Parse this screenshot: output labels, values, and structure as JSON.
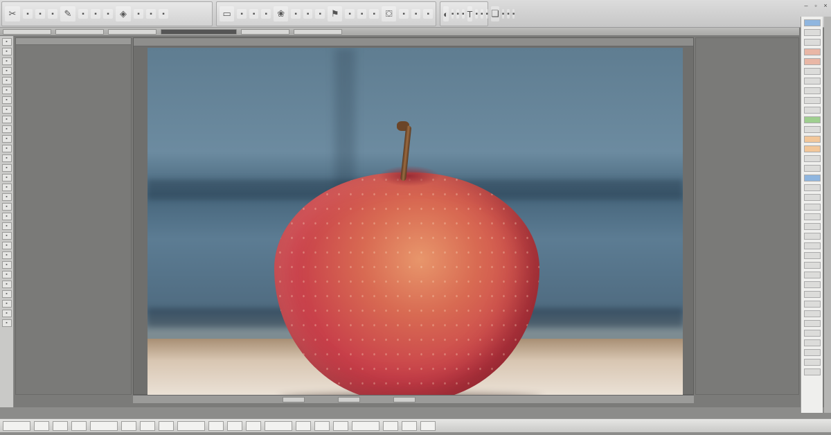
{
  "ribbon": {
    "groups": [
      {
        "buttons": [
          {
            "icon": "crop-icon",
            "glyph": "✂"
          },
          {
            "icon": "brush-icon",
            "glyph": "✎"
          },
          {
            "icon": "shape-icon",
            "glyph": "◈"
          }
        ]
      },
      {
        "buttons": [
          {
            "icon": "frame-icon",
            "glyph": "▭"
          },
          {
            "icon": "palette-icon",
            "glyph": "❀"
          },
          {
            "icon": "stamp-icon",
            "glyph": "⚑"
          },
          {
            "icon": "bucket-icon",
            "glyph": "⛋"
          }
        ]
      },
      {
        "buttons": [
          {
            "icon": "adjust-icon",
            "glyph": "◐"
          },
          {
            "icon": "text-icon",
            "glyph": "T"
          },
          {
            "icon": "layers-icon",
            "glyph": "❏"
          }
        ]
      }
    ]
  },
  "options_bar": {
    "items": [
      "",
      "",
      "",
      "",
      "",
      ""
    ]
  },
  "canvas": {
    "image_alt": ""
  },
  "status_bar": {
    "items": [
      "",
      "",
      ""
    ]
  },
  "taskbar": {
    "items": [
      "",
      "",
      "",
      "",
      "",
      "",
      "",
      "",
      "",
      "",
      "",
      "",
      "",
      "",
      "",
      "",
      "",
      "",
      "",
      ""
    ]
  },
  "right_column": {
    "items": [
      {
        "tone": "blue"
      },
      {
        "tone": "plain"
      },
      {
        "tone": "plain"
      },
      {
        "tone": "pink"
      },
      {
        "tone": "pink"
      },
      {
        "tone": "plain"
      },
      {
        "tone": "plain"
      },
      {
        "tone": "plain"
      },
      {
        "tone": "plain"
      },
      {
        "tone": "plain"
      },
      {
        "tone": "green"
      },
      {
        "tone": "plain"
      },
      {
        "tone": "orange"
      },
      {
        "tone": "orange"
      },
      {
        "tone": "plain"
      },
      {
        "tone": "plain"
      },
      {
        "tone": "blue"
      },
      {
        "tone": "plain"
      },
      {
        "tone": "plain"
      },
      {
        "tone": "plain"
      },
      {
        "tone": "plain"
      },
      {
        "tone": "plain"
      },
      {
        "tone": "plain"
      },
      {
        "tone": "plain"
      },
      {
        "tone": "plain"
      },
      {
        "tone": "plain"
      },
      {
        "tone": "plain"
      },
      {
        "tone": "plain"
      },
      {
        "tone": "plain"
      },
      {
        "tone": "plain"
      },
      {
        "tone": "plain"
      },
      {
        "tone": "plain"
      },
      {
        "tone": "plain"
      },
      {
        "tone": "plain"
      },
      {
        "tone": "plain"
      },
      {
        "tone": "plain"
      },
      {
        "tone": "plain"
      }
    ]
  },
  "colors": {
    "workspace": "#7b7b79",
    "apple_red": "#c8404a",
    "backdrop_blue": "#5c7c93"
  }
}
